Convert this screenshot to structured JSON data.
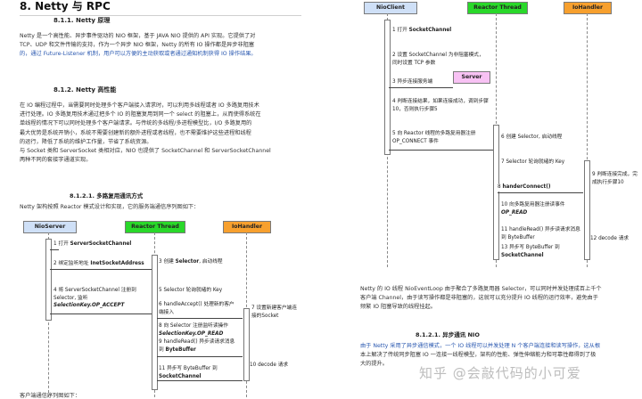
{
  "left": {
    "section_title": "8. Netty 与 RPC",
    "s811_title": "8.1.1.  Netty 原理",
    "s811_p1": "Netty 是一个高性能、异步事件驱动的 NIO 框架，基于 JAVA NIO 提供的 API 实现。它提供了对",
    "s811_p2": "TCP、UDP 和文件传输的支持，作为一个异步 NIO 框架，Netty 的所有 IO 操作都是异步非阻塞",
    "s811_p3": "的，通过 Future-Listener 机制，用户可以方便的主动获取或者通过通知机制获得 IO 操作结果。",
    "s812_title": "8.1.2.  Netty 高性能",
    "s812_lines": [
      "在 IO 编程过程中，当需要同时处理多个客户端接入请求时，可以利用多线程或者 IO 多路复用技术",
      "进行处理。IO 多路复用技术通过把多个 IO 的阻塞复用到同一个 select 的阻塞上，从而使得系统在",
      "单线程的情况下可以同时处理多个客户端请求。与传统的多线程/多进程模型比，I/O 多路复用的",
      "最大优势是系统开销小，系统不需要创建新的额外进程或者线程，也不需要维护这些进程和线程",
      "的运行，降低了系统的维护工作量，节省了系统资源。",
      "与 Socket 类和 ServerSocket 类相对应，NIO 也提供了 SocketChannel 和 ServerSocketChannel",
      "两种不同的套接字通道实现。"
    ],
    "s8121_title": "8.1.2.1.      多路复用通讯方式",
    "s8121_p": "Netty 架构按照 Reactor 模式设计和实现，它的服务端通信序列图如下：",
    "footer_cut": "客户端通信序列图如下：",
    "diagram": {
      "box1": "NioServer",
      "box2": "Reactor Thread",
      "box3": "IoHandler",
      "steps": [
        {
          "num": "1",
          "text": "打开 ",
          "bold": "ServerSocketChannel"
        },
        {
          "num": "2",
          "text": "绑定监听地址 ",
          "bold": "InetSocketAddress"
        },
        {
          "num": "3",
          "text": "创建 ",
          "bold": "Selector",
          "tail": ", 启动线程"
        },
        {
          "num": "4",
          "text": "将 ServerSocketChannel 注册到 Selector, 监听",
          "italic": "SelectionKey.OP_ACCEPT"
        },
        {
          "num": "5",
          "text": "Selector 轮询就绪的 Key"
        },
        {
          "num": "6",
          "text": "handleAccept() 处理新的客户端接入"
        },
        {
          "num": "7",
          "text": "设置新建客户端连接的Socket"
        },
        {
          "num": "8",
          "text": "向 Selector 注册监听读操作 ",
          "italic": "SelectionKey.OP_READ"
        },
        {
          "num": "9",
          "text": "handleRead() 异步读请求消息到 ",
          "bold": "ByteBuffer"
        },
        {
          "num": "10",
          "text": "decode 请求"
        },
        {
          "num": "11",
          "text": "异步写 ByteBuffer 到 ",
          "bold": "SocketChannel"
        }
      ]
    }
  },
  "right": {
    "diagram": {
      "box1": "NioClient",
      "box2": "Reactor Thread",
      "box3": "IoHandler",
      "server_box": "Server",
      "steps": [
        {
          "num": "1",
          "text": "打开 ",
          "bold": "SocketChannel"
        },
        {
          "num": "2",
          "text": "设置 SocketChannel 为非阻塞模式，同时设置 TCP 参数"
        },
        {
          "num": "3",
          "text": "异步连接服务端"
        },
        {
          "num": "4",
          "text": "判断连接结果，如果连接成功，调到步骤10，否则执行步骤5"
        },
        {
          "num": "5",
          "text": "向 Reactor 线程的多路复用器注册 OP_CONNECT 事件"
        },
        {
          "num": "6",
          "text": "创建 Selector, 启动线程"
        },
        {
          "num": "7",
          "text": "Selector 轮询就绪的 Key"
        },
        {
          "num": "8",
          "text": "handerConnect()"
        },
        {
          "num": "9",
          "text": "判断连接完成，完成执行步骤10"
        },
        {
          "num": "10",
          "text": "向多路复用器注册读事件 ",
          "italic": "OP_READ"
        },
        {
          "num": "11",
          "text": "handleRead() 异步读请求消息到 ByteBuffer"
        },
        {
          "num": "12",
          "text": "decode 请求"
        },
        {
          "num": "13",
          "text": "异步写 ByteBuffer 到 ",
          "bold": "SocketChannel"
        }
      ]
    },
    "p1a": "Netty 的 IO 线程 NioEventLoop 由于聚合了多路复用器 Selector，可以同时并发处理成百上千个",
    "p1b": "客户端 Channel，由于读写操作都是非阻塞的，这就可以充分提升 IO 线程的运行效率，避免由于",
    "p1c": "频繁 IO 阻塞导致的线程挂起。",
    "s8122_title": "8.1.2.1.      异步通讯 NIO",
    "p2a": "由于 Netty 采用了异步通信模式，一个 IO 线程可以并发处理 N 个客户端连接和读写操作，这从根",
    "p2b": "本上解决了传统同步阻塞 IO 一连接一线程模型，架构的性能、弹性伸缩能力和可靠性都得到了极",
    "p2c": "大的提升。"
  },
  "watermark": {
    "text": "知乎 @会敲代码的小可爱"
  },
  "colors": {
    "blue_box": "#cfe0f7",
    "green_box": "#29d82a",
    "orange_box": "#f7a02e",
    "server_box": "#f8c2f4",
    "link_blue": "#2a58b0"
  }
}
